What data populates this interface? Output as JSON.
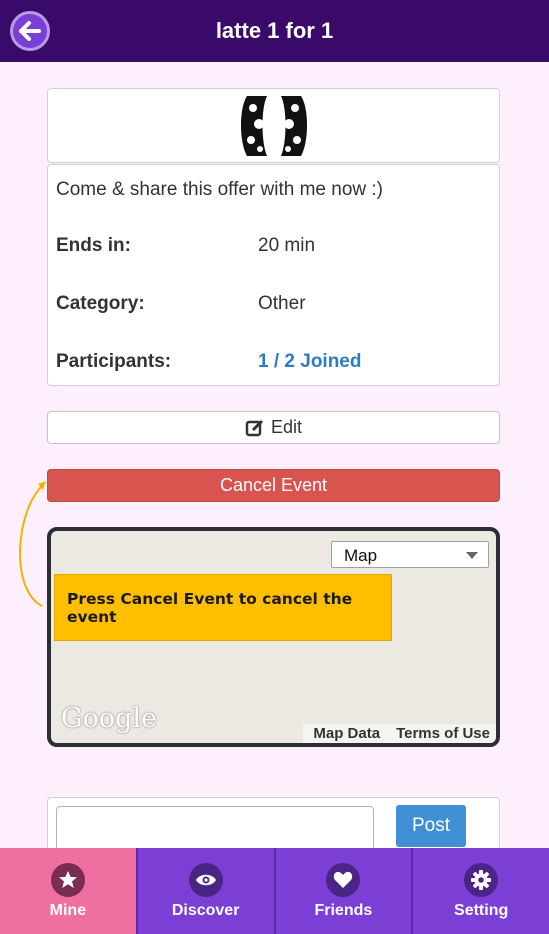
{
  "header": {
    "title": "latte 1 for 1"
  },
  "event": {
    "description": "Come & share this offer with me now :)",
    "rows": [
      {
        "label": "Ends in:",
        "value": "20 min"
      },
      {
        "label": "Category:",
        "value": "Other"
      },
      {
        "label": "Participants:",
        "value": "1 / 2 Joined"
      }
    ]
  },
  "actions": {
    "edit_label": "Edit",
    "cancel_label": "Cancel Event"
  },
  "map": {
    "type_selected": "Map",
    "logo_text": "Google",
    "footer_data": "Map Data",
    "footer_terms": "Terms of Use"
  },
  "tooltip": {
    "text": "Press Cancel Event to cancel the event"
  },
  "post": {
    "button_label": "Post",
    "input_value": ""
  },
  "tabs": [
    {
      "label": "Mine",
      "icon": "star-icon"
    },
    {
      "label": "Discover",
      "icon": "eye-icon"
    },
    {
      "label": "Friends",
      "icon": "heart-icon"
    },
    {
      "label": "Setting",
      "icon": "gear-icon"
    }
  ],
  "colors": {
    "header": "#3a0a6b",
    "cancel": "#d9534f",
    "link": "#2f7bc2",
    "tooltip": "#ffbf00",
    "tab": "#7b3fd6",
    "tab_active": "#ef6fa0"
  }
}
